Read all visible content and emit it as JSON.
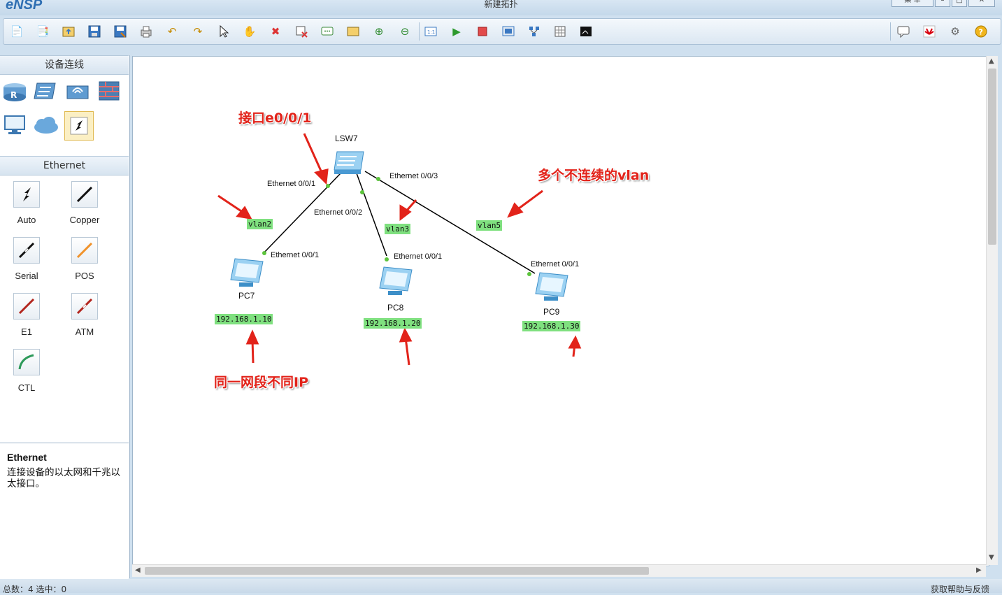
{
  "window": {
    "app_name": "eNSP",
    "title": "新建拓扑",
    "menu_label": "菜 单"
  },
  "left_pane": {
    "device_section_title": "设备连线",
    "device_icons": [
      "router-icon",
      "switch-icon",
      "wireless-icon",
      "firewall-icon",
      "pc-icon",
      "cloud-icon",
      "connection-icon"
    ],
    "cable_section_title": "Ethernet",
    "cables": [
      {
        "label": "Auto",
        "color": "#111111"
      },
      {
        "label": "Copper",
        "color": "#111111"
      },
      {
        "label": "Serial",
        "color": "#111111"
      },
      {
        "label": "POS",
        "color": "#f0922b"
      },
      {
        "label": "E1",
        "color": "#b3261e"
      },
      {
        "label": "ATM",
        "color": "#b3261e"
      },
      {
        "label": "CTL",
        "color": "#2e9a5a"
      }
    ],
    "desc_title": "Ethernet",
    "desc_text": "连接设备的以太网和千兆以太接口。"
  },
  "topology": {
    "switch": {
      "name": "LSW7"
    },
    "pcs": [
      {
        "name": "PC7",
        "ip": "192.168.1.10",
        "port": "Ethernet 0/0/1",
        "vlan": "vlan2",
        "switch_port": "Ethernet 0/0/1"
      },
      {
        "name": "PC8",
        "ip": "192.168.1.20",
        "port": "Ethernet 0/0/1",
        "vlan": "vlan3",
        "switch_port": "Ethernet 0/0/2"
      },
      {
        "name": "PC9",
        "ip": "192.168.1.30",
        "port": "Ethernet 0/0/1",
        "vlan": "vlan5",
        "switch_port": "Ethernet 0/0/3"
      }
    ]
  },
  "annotations": {
    "interface": "接口e0/0/1",
    "multi_vlan": "多个不连续的vlan",
    "same_subnet": "同一网段不同IP"
  },
  "status": {
    "left": "总数：4  选中：0",
    "right": "获取帮助与反馈"
  }
}
